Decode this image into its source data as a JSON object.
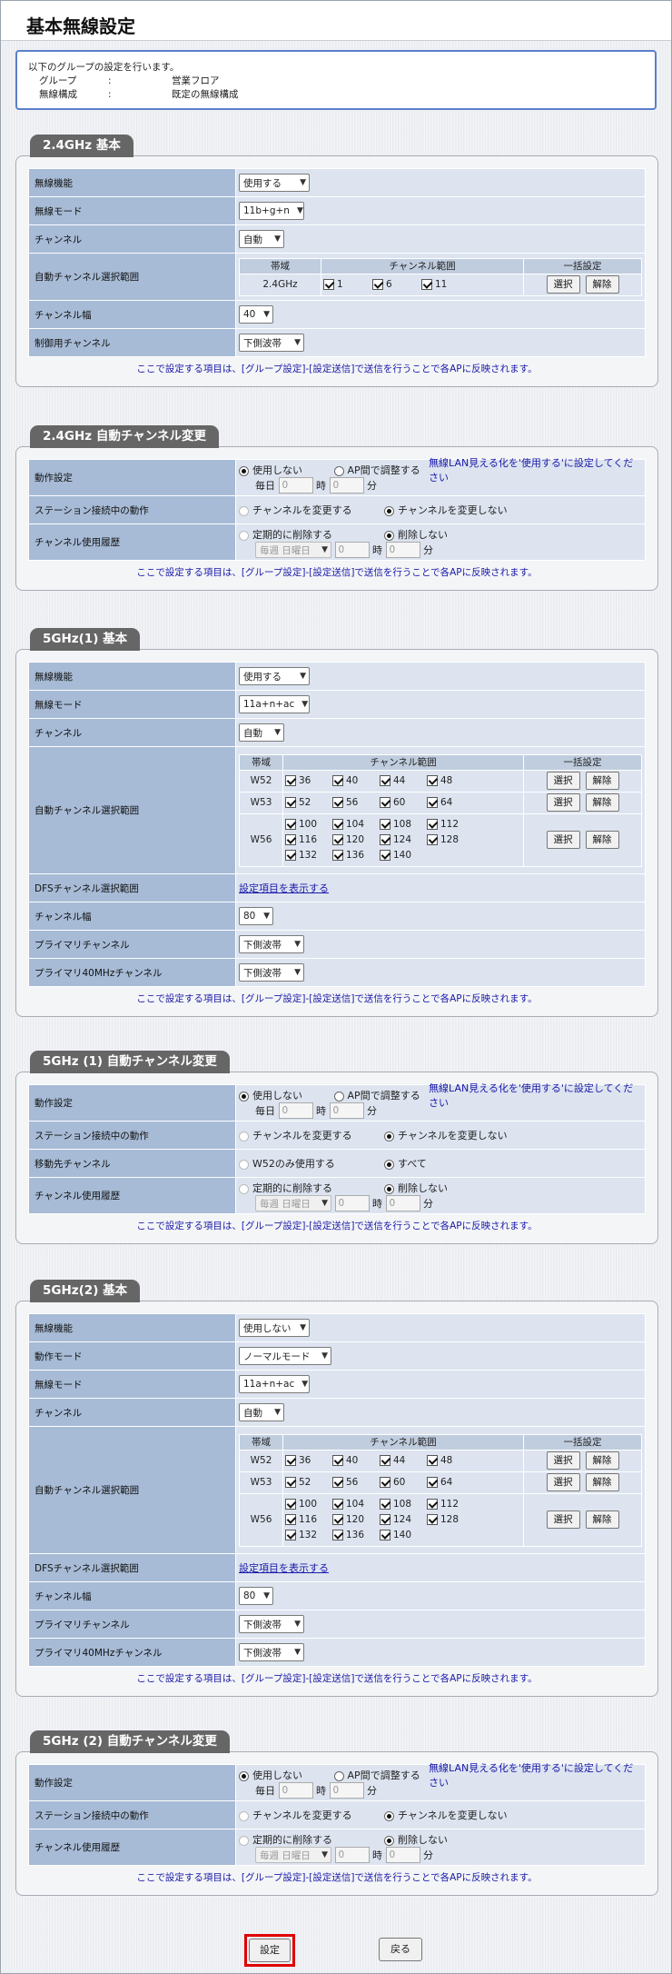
{
  "page": {
    "title": "基本無線設定"
  },
  "info": {
    "intro": "以下のグループの設定を行います。",
    "rows": [
      {
        "key": "グループ",
        "colon": ":",
        "value": "営業フロア"
      },
      {
        "key": "無線構成",
        "colon": ":",
        "value": "既定の無線構成"
      }
    ]
  },
  "common": {
    "note": "ここで設定する項目は、[グループ設定]-[設定送信]で送信を行うことで各APに反映されます。",
    "band_hdr": "帯域",
    "range_hdr": "チャンネル範囲",
    "bulk_hdr": "一括設定",
    "select": "選択",
    "clear": "解除",
    "show_link": "設定項目を表示する",
    "every": "毎日",
    "hour": "時",
    "minute": "分",
    "hour_val": "0",
    "min_val": "0",
    "weekly": "毎週 日曜日",
    "ssid_note": "無線LAN見える化を'使用する'に設定してください"
  },
  "s24": {
    "title": "2.4GHz 基本",
    "lbl": {
      "wireless": "無線機能",
      "mode": "無線モード",
      "channel": "チャンネル",
      "auto_range": "自動チャンネル選択範囲",
      "width": "チャンネル幅",
      "ctrl": "制御用チャンネル"
    },
    "wireless": "使用する",
    "mode": "11b+g+n",
    "channel": "自動",
    "band": "2.4GHz",
    "chans": [
      "1",
      "6",
      "11"
    ],
    "width": "40",
    "ctrl": "下側波帯"
  },
  "s24a": {
    "title": "2.4GHz 自動チャンネル変更",
    "lbl": {
      "op": "動作設定",
      "sta": "ステーション接続中の動作",
      "hist": "チャンネル使用履歴"
    },
    "op_off": "使用しない",
    "op_adj": "AP間で調整する",
    "sta_change": "チャンネルを変更する",
    "sta_keep": "チャンネルを変更しない",
    "hist_del": "定期的に削除する",
    "hist_keep": "削除しない"
  },
  "s5a": {
    "title": "5GHz(1) 基本",
    "lbl": {
      "wireless": "無線機能",
      "mode": "無線モード",
      "channel": "チャンネル",
      "auto_range": "自動チャンネル選択範囲",
      "dfs": "DFSチャンネル選択範囲",
      "width": "チャンネル幅",
      "primary": "プライマリチャンネル",
      "primary40": "プライマリ40MHzチャンネル"
    },
    "wireless": "使用する",
    "mode": "11a+n+ac",
    "channel": "自動",
    "w52": "W52",
    "w53": "W53",
    "w56": "W56",
    "w52c": [
      "36",
      "40",
      "44",
      "48"
    ],
    "w53c": [
      "52",
      "56",
      "60",
      "64"
    ],
    "w56c": [
      "100",
      "104",
      "108",
      "112",
      "116",
      "120",
      "124",
      "128",
      "132",
      "136",
      "140"
    ],
    "width": "80",
    "primary": "下側波帯",
    "primary40": "下側波帯"
  },
  "s5aa": {
    "title": "5GHz (1) 自動チャンネル変更",
    "lbl": {
      "op": "動作設定",
      "sta": "ステーション接続中の動作",
      "dest": "移動先チャンネル",
      "hist": "チャンネル使用履歴"
    },
    "dest_w52": "W52のみ使用する",
    "dest_all": "すべて"
  },
  "s5b": {
    "title": "5GHz(2) 基本",
    "lbl": {
      "wireless": "無線機能",
      "opmode": "動作モード",
      "mode": "無線モード",
      "channel": "チャンネル",
      "auto_range": "自動チャンネル選択範囲",
      "dfs": "DFSチャンネル選択範囲",
      "width": "チャンネル幅",
      "primary": "プライマリチャンネル",
      "primary40": "プライマリ40MHzチャンネル"
    },
    "wireless": "使用しない",
    "opmode": "ノーマルモード",
    "mode": "11a+n+ac",
    "channel": "自動",
    "width": "80",
    "primary": "下側波帯",
    "primary40": "下側波帯"
  },
  "s5ba": {
    "title": "5GHz (2) 自動チャンネル変更"
  },
  "buttons": {
    "submit": "設定",
    "back": "戻る"
  }
}
